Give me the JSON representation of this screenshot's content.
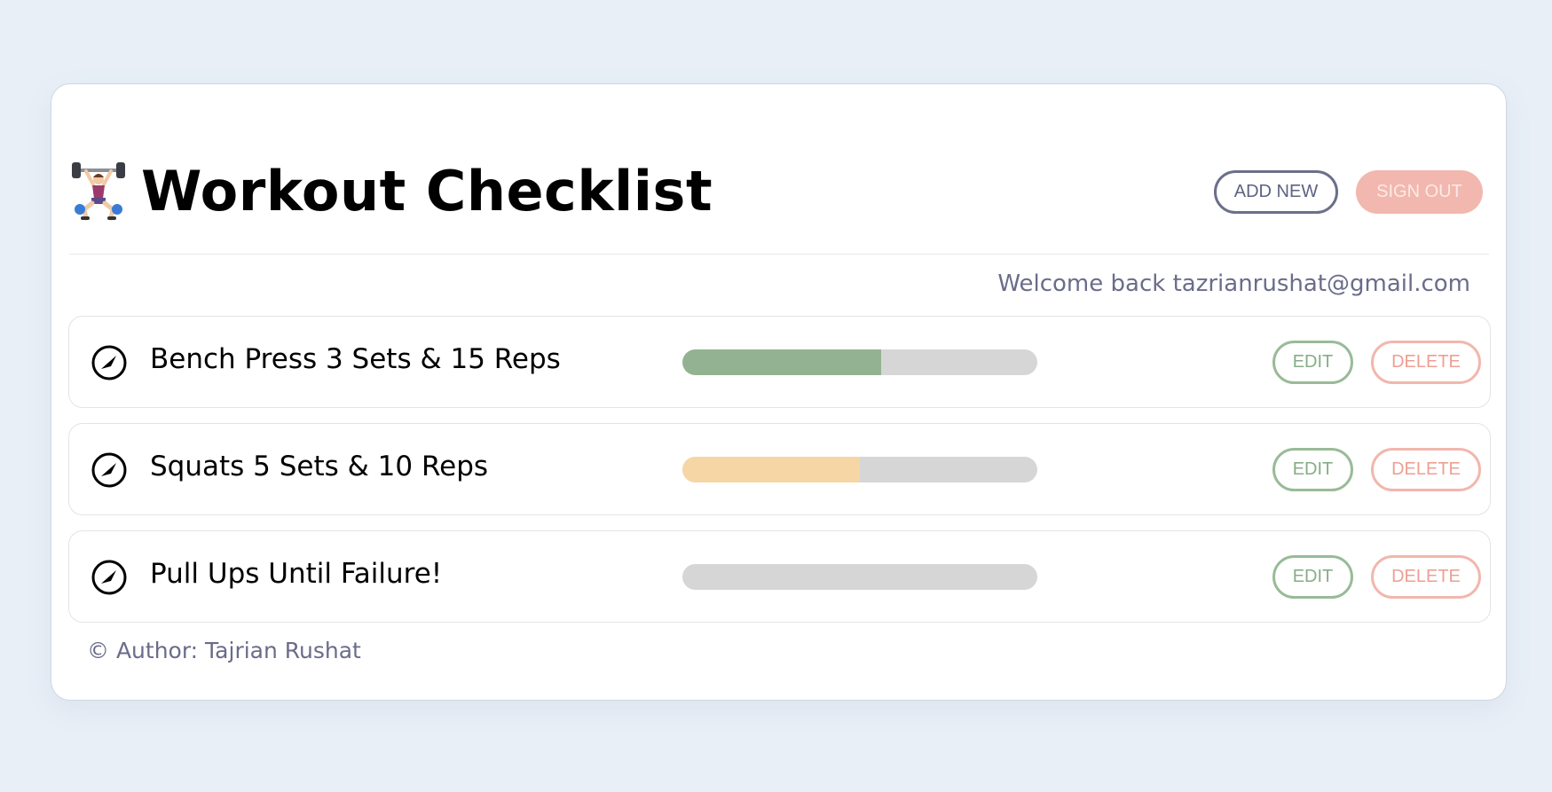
{
  "app": {
    "title": "Workout Checklist",
    "title_icon": "weightlifter-emoji"
  },
  "header": {
    "add_label": "ADD NEW",
    "signout_label": "SIGN OUT"
  },
  "welcome": {
    "text": "Welcome back tazrianrushat@gmail.com"
  },
  "workouts": [
    {
      "label": "Bench Press 3 Sets & 15 Reps",
      "icon": "compass-check-icon",
      "progress": 0.56,
      "color": "#93b291",
      "edit_label": "EDIT",
      "delete_label": "DELETE"
    },
    {
      "label": "Squats 5 Sets & 10 Reps",
      "icon": "compass-check-icon",
      "progress": 0.5,
      "color": "#f6d6a4",
      "edit_label": "EDIT",
      "delete_label": "DELETE"
    },
    {
      "label": "Pull Ups Until Failure!",
      "icon": "compass-check-icon",
      "progress": 0,
      "color": "#d6d6d6",
      "edit_label": "EDIT",
      "delete_label": "DELETE"
    }
  ],
  "footer": {
    "text": "© Author: Tajrian Rushat"
  },
  "colors": {
    "background": "#e8eff7",
    "add_border": "#6b7089",
    "signout_bg": "#f2b7ae",
    "edit_border": "#99bb98",
    "delete_border": "#f1b7ad",
    "track": "#d6d6d6"
  }
}
